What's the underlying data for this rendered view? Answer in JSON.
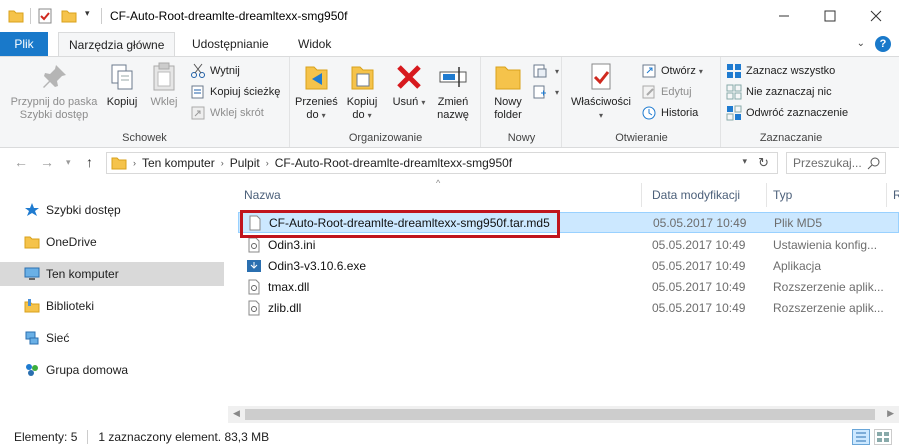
{
  "window": {
    "title": "CF-Auto-Root-dreamlte-dreamltexx-smg950f"
  },
  "tabs": {
    "file": "Plik",
    "tools": "Narzędzia główne",
    "share": "Udostępnianie",
    "view": "Widok"
  },
  "ribbon": {
    "clipboard": {
      "label": "Schowek",
      "pin": "Przypnij do paska Szybki dostęp",
      "copy": "Kopiuj",
      "paste": "Wklej",
      "cut": "Wytnij",
      "copy_path": "Kopiuj ścieżkę",
      "paste_shortcut": "Wklej skrót"
    },
    "organize": {
      "label": "Organizowanie",
      "move_to": "Przenieś do",
      "copy_to": "Kopiuj do",
      "delete": "Usuń",
      "rename": "Zmień nazwę"
    },
    "new": {
      "label": "Nowy",
      "new_folder": "Nowy folder"
    },
    "open": {
      "label": "Otwieranie",
      "properties": "Właściwości",
      "open": "Otwórz",
      "edit": "Edytuj",
      "history": "Historia"
    },
    "select": {
      "label": "Zaznaczanie",
      "select_all": "Zaznacz wszystko",
      "select_none": "Nie zaznaczaj nic",
      "invert": "Odwróć zaznaczenie"
    }
  },
  "address": {
    "crumbs": [
      "Ten komputer",
      "Pulpit",
      "CF-Auto-Root-dreamlte-dreamltexx-smg950f"
    ],
    "search_placeholder": "Przeszukaj..."
  },
  "nav": {
    "items": [
      "Szybki dostęp",
      "OneDrive",
      "Ten komputer",
      "Biblioteki",
      "Sieć",
      "Grupa domowa"
    ]
  },
  "columns": {
    "name": "Nazwa",
    "date": "Data modyfikacji",
    "type": "Typ",
    "size": "R"
  },
  "files": [
    {
      "name": "CF-Auto-Root-dreamlte-dreamltexx-smg950f.tar.md5",
      "date": "05.05.2017 10:49",
      "type": "Plik MD5"
    },
    {
      "name": "Odin3.ini",
      "date": "05.05.2017 10:49",
      "type": "Ustawienia konfig..."
    },
    {
      "name": "Odin3-v3.10.6.exe",
      "date": "05.05.2017 10:49",
      "type": "Aplikacja"
    },
    {
      "name": "tmax.dll",
      "date": "05.05.2017 10:49",
      "type": "Rozszerzenie aplik..."
    },
    {
      "name": "zlib.dll",
      "date": "05.05.2017 10:49",
      "type": "Rozszerzenie aplik..."
    }
  ],
  "status": {
    "count": "Elementy: 5",
    "selection": "1 zaznaczony element. 83,3 MB"
  },
  "colors": {
    "accent": "#1979ca",
    "selection": "#cce8ff",
    "highlight": "#c0141d"
  }
}
